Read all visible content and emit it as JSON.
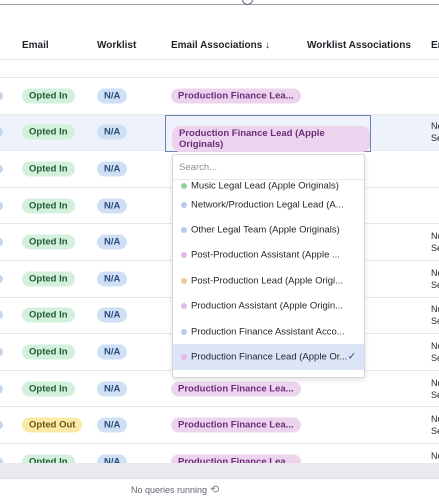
{
  "columns": {
    "email": "Email",
    "worklist": "Worklist",
    "email_associations": "Email Associations",
    "sort_indicator": "↓",
    "worklist_associations": "Worklist Associations",
    "last": "Er"
  },
  "rows": [
    {
      "email": "Opted In",
      "worklist": "N/A",
      "assoc": "Production Finance Lea...",
      "last": [
        "",
        ""
      ],
      "partial": true
    },
    {
      "email": "Opted In",
      "worklist": "N/A",
      "assoc": "Production Finance Lea...",
      "last": [
        "",
        ""
      ]
    },
    {
      "email": "Opted In",
      "worklist": "N/A",
      "assoc": "",
      "last": [
        "No",
        "Se"
      ],
      "highlight": true
    },
    {
      "email": "Opted In",
      "worklist": "N/A",
      "assoc": "",
      "last": [
        "",
        ""
      ]
    },
    {
      "email": "Opted In",
      "worklist": "N/A",
      "assoc": "",
      "last": [
        "",
        ""
      ]
    },
    {
      "email": "Opted In",
      "worklist": "N/A",
      "assoc": "",
      "last": [
        "No",
        "Se"
      ]
    },
    {
      "email": "Opted In",
      "worklist": "N/A",
      "assoc": "",
      "last": [
        "No",
        "Se"
      ]
    },
    {
      "email": "Opted In",
      "worklist": "N/A",
      "assoc": "",
      "last": [
        "No",
        "Se"
      ]
    },
    {
      "email": "Opted In",
      "worklist": "N/A",
      "assoc": "",
      "last": [
        "No",
        "Se"
      ]
    },
    {
      "email": "Opted In",
      "worklist": "N/A",
      "assoc": "Production Finance Lea...",
      "last": [
        "No",
        "Se"
      ]
    },
    {
      "email": "Opted Out",
      "worklist": "N/A",
      "assoc": "Production Finance Lea...",
      "last": [
        "No",
        "Se"
      ]
    },
    {
      "email": "Opted In",
      "worklist": "N/A",
      "assoc": "Production Finance Lea...",
      "last": [
        "No",
        "Se"
      ]
    }
  ],
  "editor": {
    "value": "Production Finance Lead (Apple Originals)"
  },
  "dropdown": {
    "search_placeholder": "Search...",
    "options": [
      {
        "label": "Music Legal Lead (Apple Originals)",
        "dot": "#8fd3a4"
      },
      {
        "label": "Network/Production Legal Lead (A...",
        "dot": "#b9c9ec"
      },
      {
        "label": "Other Legal Team (Apple Originals)",
        "dot": "#b9c9ec"
      },
      {
        "label": "Post-Production Assistant (Apple ...",
        "dot": "#e2b9e6"
      },
      {
        "label": "Post-Production Lead (Apple Origi...",
        "dot": "#f0c9a3"
      },
      {
        "label": "Production Assistant (Apple Origin...",
        "dot": "#d9c0ee"
      },
      {
        "label": "Production Finance Assistant Acco...",
        "dot": "#b9c9ec"
      },
      {
        "label": "Production Finance Lead (Apple Or...",
        "dot": "#e2b9e6",
        "selected": true
      }
    ],
    "check_icon": "✓"
  },
  "footer": {
    "status": "No queries running",
    "refresh_icon": "⟲"
  },
  "colors": {
    "accent": "#6b82b0",
    "opt_in_bg": "#d3f0dc",
    "opt_out_bg": "#fbe9a8",
    "na_bg": "#cfe0f5",
    "assoc_bg": "#ecd4ef"
  }
}
